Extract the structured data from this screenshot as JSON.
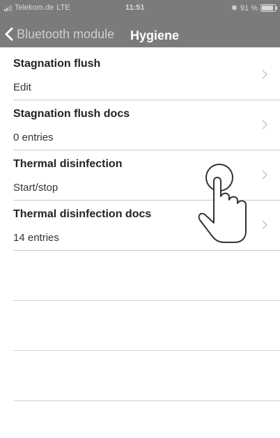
{
  "status_bar": {
    "carrier": "Telekom.de",
    "network": "LTE",
    "time": "11:51",
    "battery": "91 %"
  },
  "nav": {
    "back_label": "Bluetooth module",
    "title": "Hygiene"
  },
  "rows": [
    {
      "title": "Stagnation flush",
      "subtitle": "Edit"
    },
    {
      "title": "Stagnation flush docs",
      "subtitle": "0 entries"
    },
    {
      "title": "Thermal disinfection",
      "subtitle": "Start/stop"
    },
    {
      "title": "Thermal disinfection docs",
      "subtitle": "14 entries"
    }
  ],
  "colors": {
    "header": "#7b7b7b",
    "separator": "#c8c8c8"
  },
  "icons": {
    "tap_hint": "hand-pointer-icon",
    "row_chevron": "chevron-right-icon",
    "back": "chevron-left-icon"
  }
}
